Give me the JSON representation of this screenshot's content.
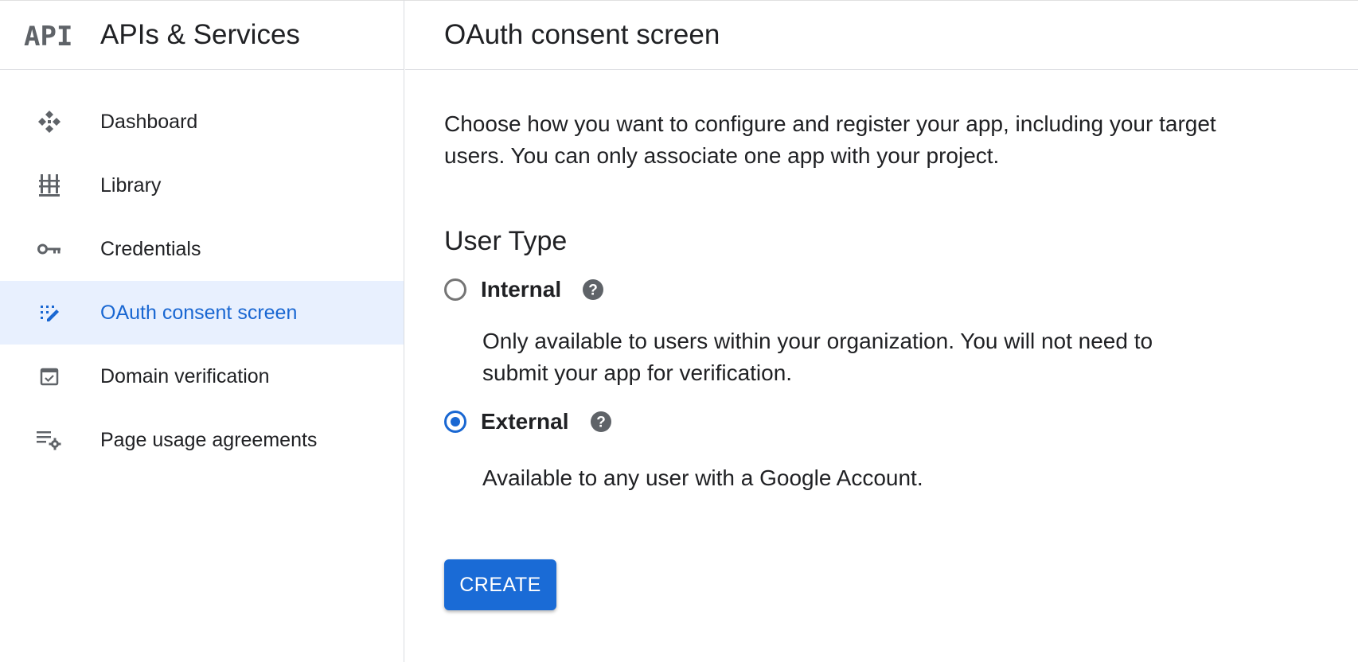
{
  "app": {
    "logo_text": "API",
    "title": "APIs & Services"
  },
  "sidebar": {
    "items": [
      {
        "label": "Dashboard",
        "icon": "dashboard-icon",
        "active": false
      },
      {
        "label": "Library",
        "icon": "library-icon",
        "active": false
      },
      {
        "label": "Credentials",
        "icon": "key-icon",
        "active": false
      },
      {
        "label": "OAuth consent screen",
        "icon": "oauth-consent-icon",
        "active": true
      },
      {
        "label": "Domain verification",
        "icon": "domain-verification-icon",
        "active": false
      },
      {
        "label": "Page usage agreements",
        "icon": "settings-list-icon",
        "active": false
      }
    ]
  },
  "main": {
    "title": "OAuth consent screen",
    "description": "Choose how you want to configure and register your app, including your target users. You can only associate one app with your project.",
    "section_title": "User Type",
    "options": [
      {
        "label": "Internal",
        "description": "Only available to users within your organization. You will not need to submit your app for verification.",
        "selected": false
      },
      {
        "label": "External",
        "description": "Available to any user with a Google Account.",
        "selected": true
      }
    ],
    "create_label": "CREATE"
  },
  "colors": {
    "accent": "#1967d2",
    "active_bg": "#e8f0fe",
    "button_bg": "#1a6bd6"
  }
}
